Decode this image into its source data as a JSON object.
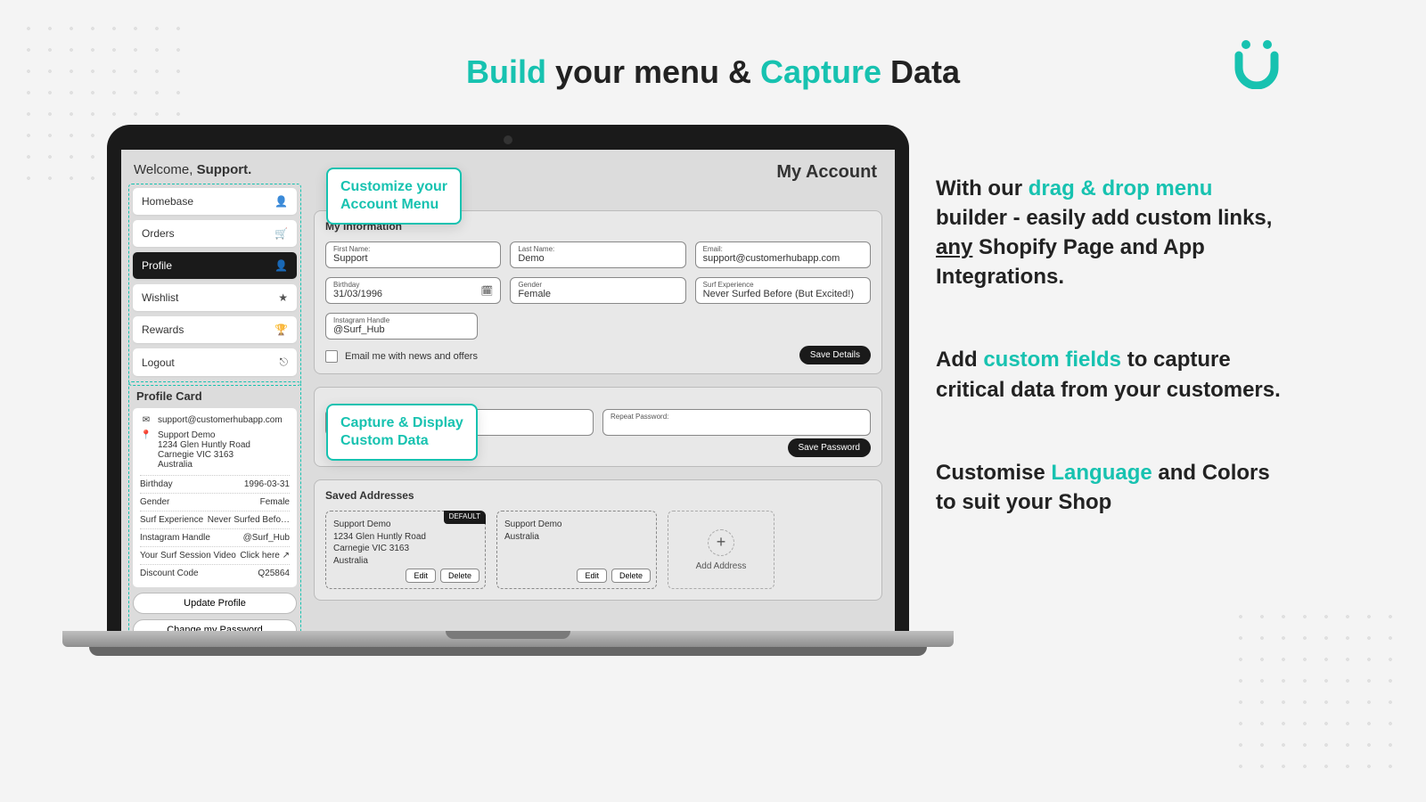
{
  "headline": {
    "p1": "Build",
    "p2": " your menu & ",
    "p3": "Capture",
    "p4": " Data"
  },
  "welcome": {
    "pre": "Welcome, ",
    "name": "Support."
  },
  "pageTitle": "My Account",
  "menu": [
    {
      "label": "Homebase",
      "icon": "👤",
      "active": false
    },
    {
      "label": "Orders",
      "icon": "🛒",
      "active": false
    },
    {
      "label": "Profile",
      "icon": "👤",
      "active": true
    },
    {
      "label": "Wishlist",
      "icon": "★",
      "active": false
    },
    {
      "label": "Rewards",
      "icon": "🏆",
      "active": false
    },
    {
      "label": "Logout",
      "icon": "⎋",
      "active": false
    }
  ],
  "callouts": {
    "c1a": "Customize your",
    "c1b": "Account Menu",
    "c2a": "Capture & Display",
    "c2b": "Custom Data"
  },
  "myInfo": {
    "title": "My Information",
    "fields": {
      "firstName": {
        "label": "First Name:",
        "value": "Support"
      },
      "lastName": {
        "label": "Last Name:",
        "value": "Demo"
      },
      "email": {
        "label": "Email:",
        "value": "support@customerhubapp.com"
      },
      "birthday": {
        "label": "Birthday",
        "value": "31/03/1996"
      },
      "gender": {
        "label": "Gender",
        "value": "Female"
      },
      "surf": {
        "label": "Surf Experience",
        "value": "Never Surfed Before (But Excited!)"
      },
      "insta": {
        "label": "Instagram Handle",
        "value": "@Surf_Hub"
      }
    },
    "marketing": "Email me with news and offers",
    "saveBtn": "Save Details"
  },
  "password": {
    "repeatLabel": "Repeat Password:",
    "saveBtn": "Save Password"
  },
  "addresses": {
    "title": "Saved Addresses",
    "defaultBadge": "DEFAULT",
    "editBtn": "Edit",
    "deleteBtn": "Delete",
    "addBtn": "Add Address",
    "a1": {
      "l1": "Support Demo",
      "l2": "1234 Glen Huntly Road",
      "l3": "Carnegie VIC 3163",
      "l4": "Australia"
    },
    "a2": {
      "l1": "Support Demo",
      "l2": "Australia"
    }
  },
  "profileCard": {
    "title": "Profile Card",
    "email": "support@customerhubapp.com",
    "addr": {
      "l1": "Support Demo",
      "l2": "1234 Glen Huntly Road",
      "l3": "Carnegie VIC 3163",
      "l4": "Australia"
    },
    "rows": [
      {
        "k": "Birthday",
        "v": "1996-03-31"
      },
      {
        "k": "Gender",
        "v": "Female"
      },
      {
        "k": "Surf Experience",
        "v": "Never Surfed Befo…"
      },
      {
        "k": "Instagram Handle",
        "v": "@Surf_Hub"
      },
      {
        "k": "Your Surf Session Video",
        "v": "Click here ↗"
      },
      {
        "k": "Discount Code",
        "v": "Q25864"
      }
    ],
    "updateBtn": "Update Profile",
    "pwBtn": "Change my Password"
  },
  "side": {
    "p1a": "With our ",
    "p1b": "drag & drop menu",
    "p1c": " builder - easily add custom links, ",
    "p1d": "any",
    "p1e": " Shopify Page and App Integrations.",
    "p2a": "Add ",
    "p2b": "custom fields",
    "p2c": " to capture critical data from your customers.",
    "p3a": "Customise ",
    "p3b": "Language",
    "p3c": " and Colors to suit your Shop"
  }
}
